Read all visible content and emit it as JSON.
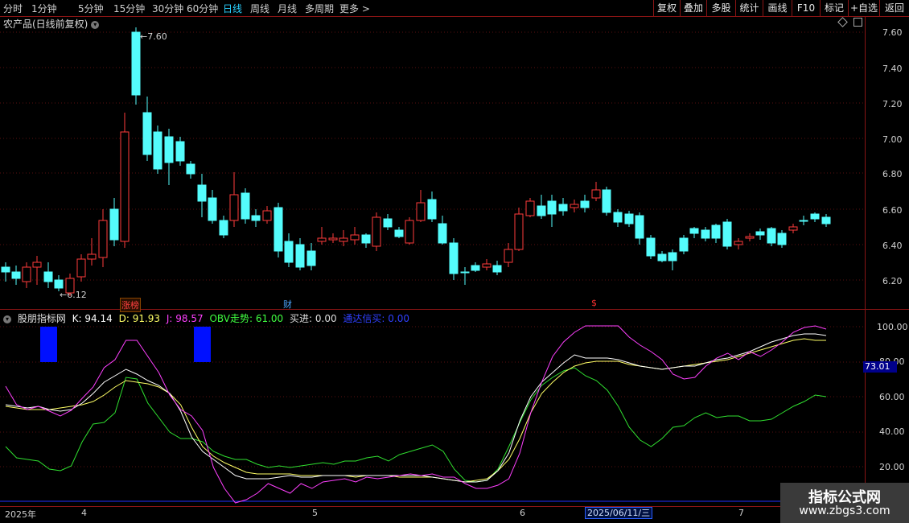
{
  "toolbar": {
    "periods": [
      "分时",
      "1分钟",
      "5分钟",
      "15分钟",
      "30分钟",
      "60分钟",
      "日线",
      "周线",
      "月线",
      "多周期",
      "更多 >"
    ],
    "active_period": "日线",
    "right_buttons": [
      "复权",
      "叠加",
      "多股",
      "统计",
      "画线",
      "F10",
      "标记",
      "+自选",
      "返回"
    ]
  },
  "main_chart": {
    "title": "农产品(日线前复权)",
    "high_label": "7.60",
    "low_label": "6.12",
    "y_ticks": [
      "7.60",
      "7.40",
      "7.20",
      "7.00",
      "6.80",
      "6.60",
      "6.40",
      "6.20"
    ],
    "event_tags": [
      {
        "text": "涨榜",
        "color": "#ff4040"
      },
      {
        "text": "财",
        "color": "#4da6ff"
      },
      {
        "text": "$",
        "color": "#ff3030"
      }
    ],
    "colors": {
      "up": "#ff3b3b",
      "down": "#54fcfc"
    }
  },
  "indicator": {
    "name": "股朋指标网",
    "params": [
      {
        "label": "K: 94.14",
        "color": "#ffffff"
      },
      {
        "label": "D: 91.93",
        "color": "#ffff66"
      },
      {
        "label": "J: 98.57",
        "color": "#ff40ff"
      },
      {
        "label": "OBV走势: 61.00",
        "color": "#40ff40"
      },
      {
        "label": "买进: 0.00",
        "color": "#dddddd"
      },
      {
        "label": "通达信买: 0.00",
        "color": "#3040ff"
      }
    ],
    "y_ticks": [
      "100.00",
      "80.00",
      "60.00",
      "40.00",
      "20.00"
    ],
    "current_value": "73.01"
  },
  "time_axis": {
    "labels": [
      "2025年",
      "4",
      "5",
      "6",
      "7"
    ],
    "cursor_date": "2025/06/11/三"
  },
  "watermark": {
    "line1": "指标公式网",
    "line2": "www.zbgs3.com"
  }
}
